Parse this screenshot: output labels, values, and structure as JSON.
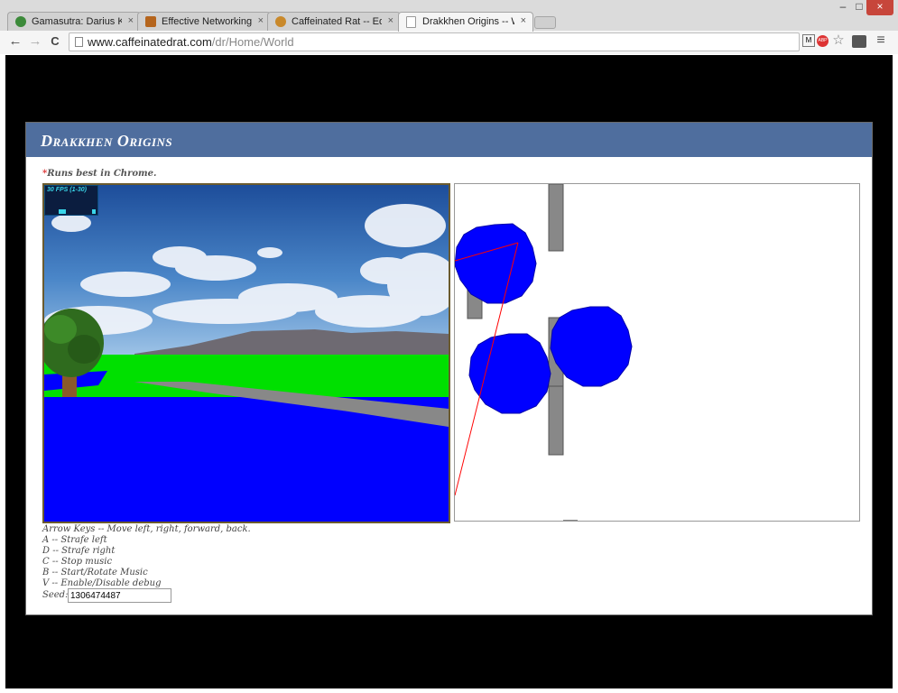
{
  "browser": {
    "tabs": [
      {
        "title": "Gamasutra: Darius Kazemi",
        "favicon_color": "#3c8a3a"
      },
      {
        "title": "Effective Networking (Get",
        "favicon_color": "#b5651d"
      },
      {
        "title": "Caffeinated Rat -- Edit Exp",
        "favicon_color": "#c9892b"
      },
      {
        "title": "Drakkhen Origins -- World",
        "favicon_color": "#ffffff"
      }
    ],
    "close_glyph": "×",
    "address": {
      "host": "www.caffeinatedrat.com",
      "path": "/dr/Home/World"
    },
    "nav": {
      "back": "←",
      "forward": "→",
      "reload": "C"
    },
    "window_controls": {
      "minimize": "–",
      "maximize": "□",
      "close": "×"
    },
    "star": "☆",
    "menu": "≡",
    "ext_abp": "ABP",
    "ext_lock": "M"
  },
  "page": {
    "title": "Drakkhen Origins",
    "note_star": "*",
    "note": "Runs best in Chrome.",
    "fps_label": "30 FPS (1-30)",
    "help_lines": [
      "Arrow Keys -- Move left, right, forward, back.",
      "A -- Strafe left",
      "D -- Strafe right",
      "C -- Stop music",
      "B -- Start/Rotate Music",
      "V -- Enable/Disable debug"
    ],
    "seed_label": "Seed:",
    "seed_value": "1306474487"
  },
  "colors": {
    "banner": "#4f6e9e",
    "water": "#0000ff",
    "grass": "#00e000",
    "road": "#888888",
    "map_circle": "#0000ff",
    "ray": "#ff0000"
  }
}
